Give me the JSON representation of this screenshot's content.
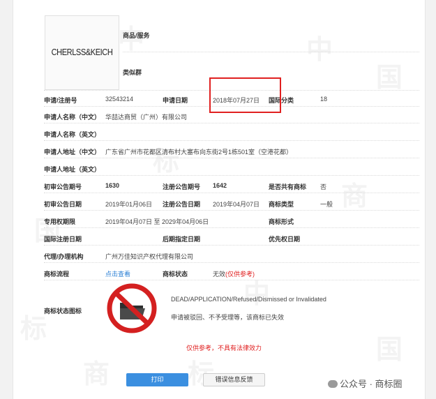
{
  "logo": {
    "text": "CHERLSS&KEICH"
  },
  "goods_label": "商品/服务",
  "similar_label": "类似群",
  "reg_no": {
    "label": "申请/注册号",
    "value": "32543214"
  },
  "apply_date": {
    "label": "申请日期",
    "value": "2018年07月27日"
  },
  "intl_class": {
    "label": "国际分类",
    "value": "18"
  },
  "applicant_cn": {
    "label": "申请人名称（中文）",
    "value": "华喆达商贸（广州）有限公司"
  },
  "applicant_en": {
    "label": "申请人名称（英文）",
    "value": ""
  },
  "address_cn": {
    "label": "申请人地址（中文）",
    "value": "广东省广州市花都区清布村大塞布向东街2号1栋501室（空港花都）"
  },
  "address_en": {
    "label": "申请人地址（英文）",
    "value": ""
  },
  "prelim_no": {
    "label": "初审公告期号",
    "value": "1630"
  },
  "reg_notice_no": {
    "label": "注册公告期号",
    "value": "1642"
  },
  "shared": {
    "label": "是否共有商标",
    "value": "否"
  },
  "prelim_date": {
    "label": "初审公告日期",
    "value": "2019年01月06日"
  },
  "reg_notice_date": {
    "label": "注册公告日期",
    "value": "2019年04月07日"
  },
  "mark_type": {
    "label": "商标类型",
    "value": "一般"
  },
  "exclusive": {
    "label": "专用权期限",
    "value": "2019年04月07日 至 2029年04月06日"
  },
  "mark_form": {
    "label": "商标形式",
    "value": ""
  },
  "intl_reg_date": {
    "label": "国际注册日期",
    "value": ""
  },
  "later_date": {
    "label": "后期指定日期",
    "value": ""
  },
  "priority_date": {
    "label": "优先权日期",
    "value": ""
  },
  "agent": {
    "label": "代理/办理机构",
    "value": "广州万佳知识产权代理有限公司"
  },
  "process": {
    "label": "商标流程",
    "value": "点击查看"
  },
  "status": {
    "label": "商标状态",
    "value": "无效",
    "note": "(仅供参考)"
  },
  "status_icon": {
    "label": "商标状态图标",
    "title": "DEAD/APPLICATION/Refused/Dismissed or Invalidated",
    "desc": "申请被驳回、不予受理等，该商标已失效"
  },
  "disclaimer": "仅供参考，不具有法律效力",
  "buttons": {
    "print": "打印",
    "feedback": "错误信息反馈"
  },
  "footer": {
    "brand": "公众号 · 商标圈"
  },
  "watermark": "中国商标",
  "colors": {
    "highlight": "#e02020",
    "link": "#2a7fd4",
    "button": "#3b8fe0"
  }
}
